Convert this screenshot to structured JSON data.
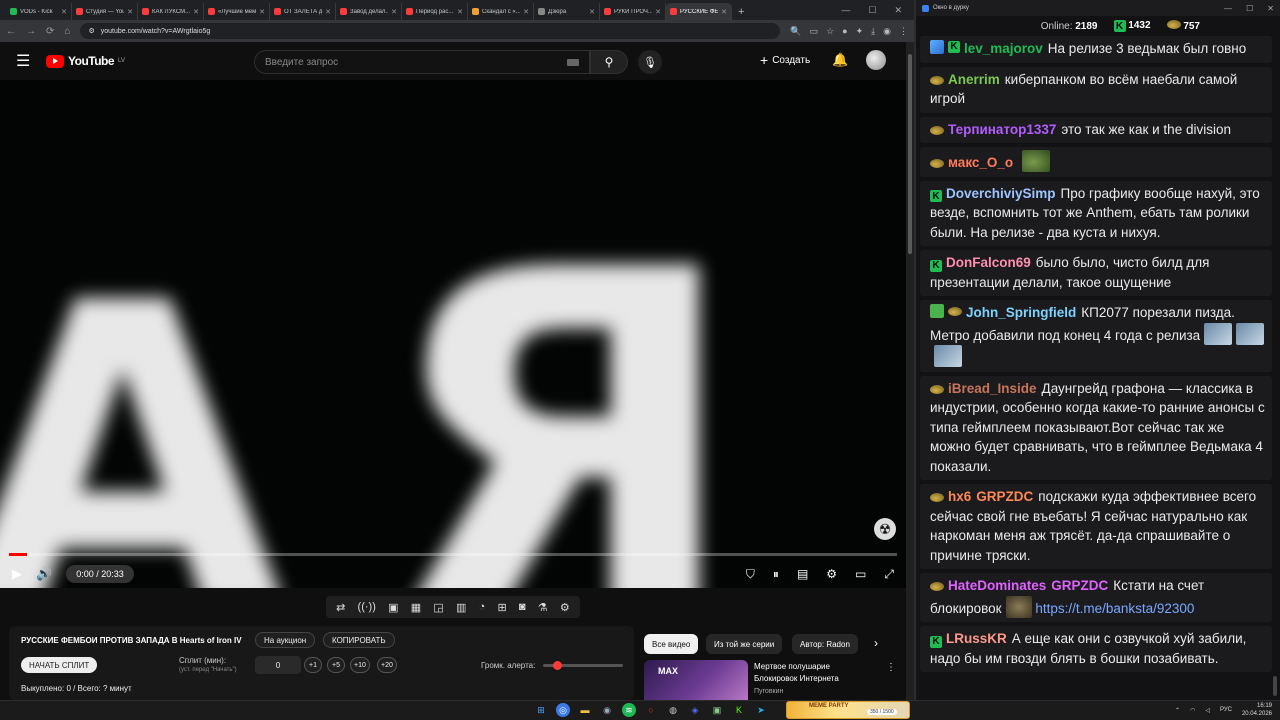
{
  "browser": {
    "tabs": [
      {
        "label": "VODs - Kick",
        "color": "#1fbb55"
      },
      {
        "label": "Студия — YouTube",
        "color": "#ff3b3b"
      },
      {
        "label": "КАК ЛУКСМ...",
        "color": "#ff3b3b"
      },
      {
        "label": "«Лучшие мем...",
        "color": "#ff3b3b"
      },
      {
        "label": "ОТ ЗАЛЕТА д...",
        "color": "#ff3b3b"
      },
      {
        "label": "Завод делал...",
        "color": "#ff3b3b"
      },
      {
        "label": "Период рас...",
        "color": "#ff3b3b"
      },
      {
        "label": "Скандал с «...",
        "color": "#f0a030"
      },
      {
        "label": "Дзюра",
        "color": "#888888"
      },
      {
        "label": "РУКИ ПРОЧ...",
        "color": "#ff3b3b"
      },
      {
        "label": "РУССКИЕ ФЕМ...",
        "color": "#ff3b3b",
        "active": true
      }
    ],
    "url": "youtube.com/watch?v=AWrgtlaio5g"
  },
  "youtube": {
    "region": "LV",
    "logo_text": "YouTube",
    "search_placeholder": "Введите запрос",
    "create_label": "Создать"
  },
  "player": {
    "time": "0:00 / 20:33",
    "progress": 0.02,
    "overlay_text": "АЯ"
  },
  "info": {
    "title": "РУССКИЕ ФЕМБОИ ПРОТИВ ЗАПАДА В Hearts of Iron IV",
    "auction_label": "На аукцион",
    "copy_label": "КОПИРОВАТЬ",
    "split_button": "НАЧАТЬ СПЛИТ",
    "split_label": "Сплит (мин):",
    "split_hint": "(уст. перед \"Начать\")",
    "split_value": "0",
    "steps": [
      "+1",
      "+5",
      "+10",
      "+20"
    ],
    "volume_label": "Громк. алерта:",
    "volume_level": 0.12,
    "sold_text": "Выкуплено: 0 / Всего: ? минут"
  },
  "chips": [
    "Все видео",
    "Из той же серии",
    "Автор: Radon"
  ],
  "recommendation": {
    "thumb_text": "MAX",
    "title": "Мертвое полушарие Блокировок Интернета",
    "channel": "Пуговкин"
  },
  "chat": {
    "window_title": "Окно в дурку",
    "online_label": "Online:",
    "online_count": "2189",
    "kick_count": "1432",
    "frog_count": "757",
    "messages": [
      {
        "badges": [
          "pin",
          "kick"
        ],
        "user": "lev_majorov",
        "color": "#1fbb55",
        "text": "На релизе 3 ведьмак был говно"
      },
      {
        "badges": [
          "frog"
        ],
        "user": "Anerrim",
        "color": "#7ec850",
        "text": "киберпанком во всём наебали самой игрой"
      },
      {
        "badges": [
          "frog"
        ],
        "user": "Терпинатор1337",
        "color": "#b35cff",
        "text": "это так же как и the division"
      },
      {
        "badges": [
          "frog"
        ],
        "user": "макс_О_о",
        "color": "#ff7a59",
        "text": "",
        "emote": "frogg"
      },
      {
        "badges": [
          "kick"
        ],
        "user": "DoverchiviySimp",
        "color": "#9dc4ff",
        "text": "Про графику вообще нахуй, это везде, вспомнить тот же Anthem, ебать там ролики были. На релизе - два куста и нихуя."
      },
      {
        "badges": [
          "kick"
        ],
        "user": "DonFalcon69",
        "color": "#ff8fb0",
        "text": "было было, чисто билд для презентации делали, такое ощущение"
      },
      {
        "badges": [
          "check",
          "frog"
        ],
        "user": "John_Springfield",
        "color": "#7fd2ff",
        "text": "КП2077 порезали пизда. Метро добавили под конец 4 года с релиза",
        "emotes_after": 3
      },
      {
        "badges": [
          "frog"
        ],
        "user": "iBread_Inside",
        "color": "#c7745a",
        "text": "Даунгрейд графона — классика в индустрии, особенно когда какие-то ранние анонсы с типа геймплеем показывают.Вот сейчас так же можно будет сравнивать, что в геймплее Ведьмака 4 показали."
      },
      {
        "badges": [
          "frog"
        ],
        "user": "hx6",
        "color": "#ff8855",
        "mention": "GRPZDC",
        "text": "подскажи куда эффективнее всего сейчас свой гне въебать! Я сейчас натурально как наркоман меня аж трясёт. да-да спрашивайте о причине тряски."
      },
      {
        "badges": [
          "frog"
        ],
        "user": "HateDominates",
        "color": "#e062ff",
        "mention": "GRPZDC",
        "text": "Кстати на счет блокировок",
        "emote_mid": "dog",
        "link": "https://t.me/banksta/92300"
      },
      {
        "badges": [
          "kick"
        ],
        "user": "LRussKR",
        "color": "#ff9a8a",
        "text": "А еще как они с озвучкой хуй забили, надо бы им гвозди блять в бошки позабивать."
      }
    ]
  },
  "taskbar": {
    "meme_title": "MEME PARTY",
    "meme_progress": "350 / 1500",
    "lang": "РУС",
    "time": "16:19",
    "date": "20.04.2026"
  }
}
